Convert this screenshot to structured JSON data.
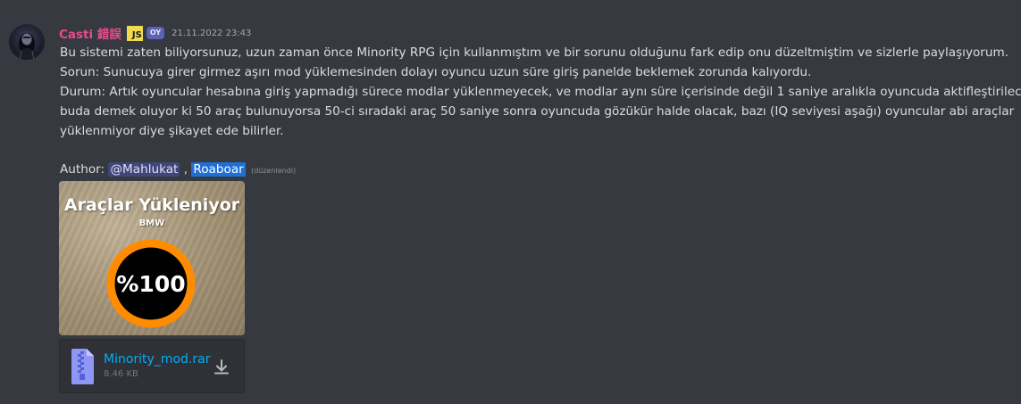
{
  "message": {
    "username": "Casti 錯誤",
    "js_badge": "JS",
    "tag": "OY",
    "timestamp": "21.11.2022 23:43",
    "lines": [
      "Bu sistemi zaten biliyorsunuz, uzun zaman önce Minority RPG için kullanmıştım ve bir sorunu olduğunu fark edip onu düzeltmiştim ve sizlerle paylaşıyorum.",
      "Sorun: Sunucuya girer girmez aşırı mod yüklemesinden dolayı oyuncu uzun süre giriş panelde beklemek zorunda kalıyordu.",
      "Durum: Artık oyuncular hesabına giriş yapmadığı sürece modlar yüklenmeyecek, ve modlar aynı süre içerisinde değil 1 saniye aralıkla oyuncuda aktifleştirilecek,",
      "buda demek oluyor ki 50 araç bulunuyorsa 50-ci sıradaki araç 50 saniye sonra oyuncuda gözükür halde olacak, bazı (IQ seviyesi aşağı) oyuncular abi araçlar",
      "yüklenmiyor diye şikayet ede bilirler."
    ],
    "author_label": "Author:",
    "mention": "@Mahlukat",
    "separator": ",",
    "second_author": "Roaboar",
    "edited": "(düzenlendi)"
  },
  "image": {
    "title": "Araçlar Yükleniyor",
    "subtitle": "BMW",
    "progress_label": "%100",
    "progress_percent": 100,
    "ring_color": "#ff8c00"
  },
  "file": {
    "name": "Minority_mod.rar",
    "size": "8.46 KB",
    "icon": "archive-file-icon",
    "download_icon": "download-icon"
  },
  "colors": {
    "background": "#36393f",
    "username": "#e94b8a",
    "link": "#00aff4",
    "mention_bg": "#5865f2"
  }
}
